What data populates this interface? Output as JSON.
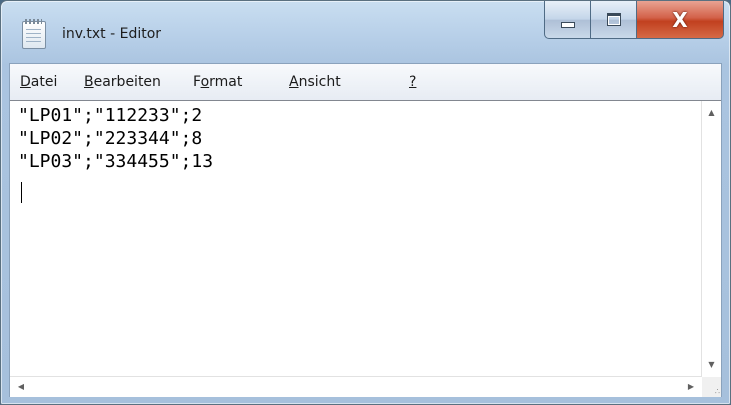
{
  "window": {
    "title": "inv.txt - Editor",
    "close_glyph": "X",
    "colors": {
      "close_button": "#c1401f",
      "frame": "#aac4e0"
    }
  },
  "menu": {
    "items": [
      {
        "label_ul": "D",
        "label_rest": "atei"
      },
      {
        "label_ul": "B",
        "label_rest": "earbeiten"
      },
      {
        "label_pre": "F",
        "label_ul": "o",
        "label_rest": "rmat"
      },
      {
        "label_ul": "A",
        "label_rest": "nsicht"
      },
      {
        "label_ul": "?",
        "label_rest": ""
      }
    ]
  },
  "editor": {
    "lines": [
      "\"LP01\";\"112233\";2",
      "\"LP02\";\"223344\";8",
      "\"LP03\";\"334455\";13"
    ]
  },
  "icons": {
    "app": "notepad-icon",
    "minimize": "minimize-icon",
    "maximize": "maximize-icon",
    "close": "close-icon"
  }
}
